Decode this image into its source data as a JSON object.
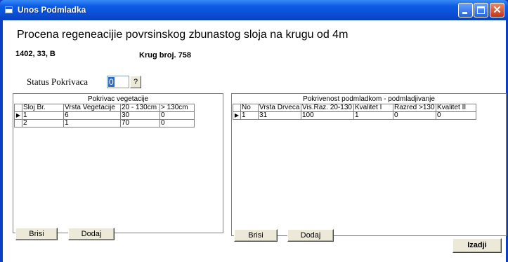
{
  "window": {
    "title": "Unos Podmladka"
  },
  "header": {
    "heading": "Procena regeneacijie povrsinskog zbunastog sloja na krugu od 4m",
    "ident": "1402, 33, B",
    "krug": "Krug broj. 758"
  },
  "status": {
    "label": "Status Pokrivaca",
    "value": "0",
    "help_label": "?"
  },
  "left_panel": {
    "title": "Pokrivac vegetacije",
    "columns": [
      "Sloj Br.",
      "Vrsta Vegetacije",
      "20 - 130cm",
      "> 130cm"
    ],
    "rows": [
      [
        "1",
        "6",
        "30",
        "0"
      ],
      [
        "2",
        "1",
        "70",
        "0"
      ]
    ],
    "delete_label": "Brisi",
    "add_label": "Dodaj"
  },
  "right_panel": {
    "title": "Pokrivenost podmladkom - podmladjivanje",
    "columns": [
      "No",
      "Vrsta Drveca",
      "Vis.Raz. 20-130",
      "Kvalitet I",
      "Razred >130",
      "Kvalitet II"
    ],
    "rows": [
      [
        "1",
        "31",
        "100",
        "1",
        "0",
        "0"
      ]
    ],
    "delete_label": "Brisi",
    "add_label": "Dodaj"
  },
  "exit_label": "Izadji",
  "icons": {
    "app": "app-window-icon",
    "minimize": "minimize-icon",
    "maximize": "maximize-icon",
    "close": "close-icon",
    "row_pointer": "row-pointer-icon"
  },
  "colors": {
    "titlebar": "#0a4fd6",
    "selection": "#316ac5",
    "button_face": "#ece9d8"
  }
}
